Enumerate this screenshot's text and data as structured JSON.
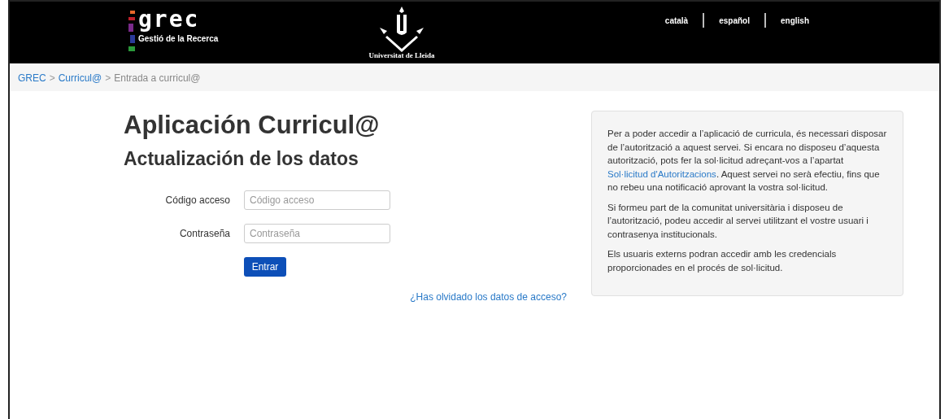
{
  "header": {
    "logo_text": "grec",
    "logo_subtitle": "Gestió de la Recerca",
    "university": "Universitat de Lleida",
    "languages": [
      {
        "label": "català"
      },
      {
        "label": "español"
      },
      {
        "label": "english"
      }
    ]
  },
  "breadcrumb": [
    {
      "label": "GREC",
      "link": true
    },
    {
      "label": "Curricul@",
      "link": true
    },
    {
      "label": "Entrada a curricul@",
      "link": false
    }
  ],
  "breadcrumb_separator": ">",
  "title": "Aplicación Curricul@",
  "subtitle": "Actualización de los datos",
  "form": {
    "fields": [
      {
        "label": "Código acceso",
        "placeholder": "Código acceso"
      },
      {
        "label": "Contraseña",
        "placeholder": "Contraseña"
      }
    ],
    "submit": "Entrar",
    "forgot_link": "¿Has olvidado los datos de acceso?"
  },
  "info": {
    "paragraphs": [
      [
        {
          "text": "Per a poder accedir a l’aplicació de curricula, és necessari disposar de l’autorització a aquest servei. Si encara no disposeu d’aquesta autorització, pots fer la sol·licitud adreçant-vos a l’apartat ",
          "link": false
        },
        {
          "text": "Sol·licitud d'Autoritzacions",
          "link": true
        },
        {
          "text": ". Aquest servei no serà efectiu, fins que no rebeu una notificació aprovant la vostra sol·licitud.",
          "link": false
        }
      ],
      [
        {
          "text": "Si formeu part de la comunitat universitària i disposeu de l’autorització, podeu accedir al servei utilitzant el vostre usuari i contrasenya institucionals.",
          "link": false
        }
      ],
      [
        {
          "text": "Els usuaris externs podran accedir amb les credencials proporcionades en el procés de sol·licitud.",
          "link": false
        }
      ]
    ]
  }
}
